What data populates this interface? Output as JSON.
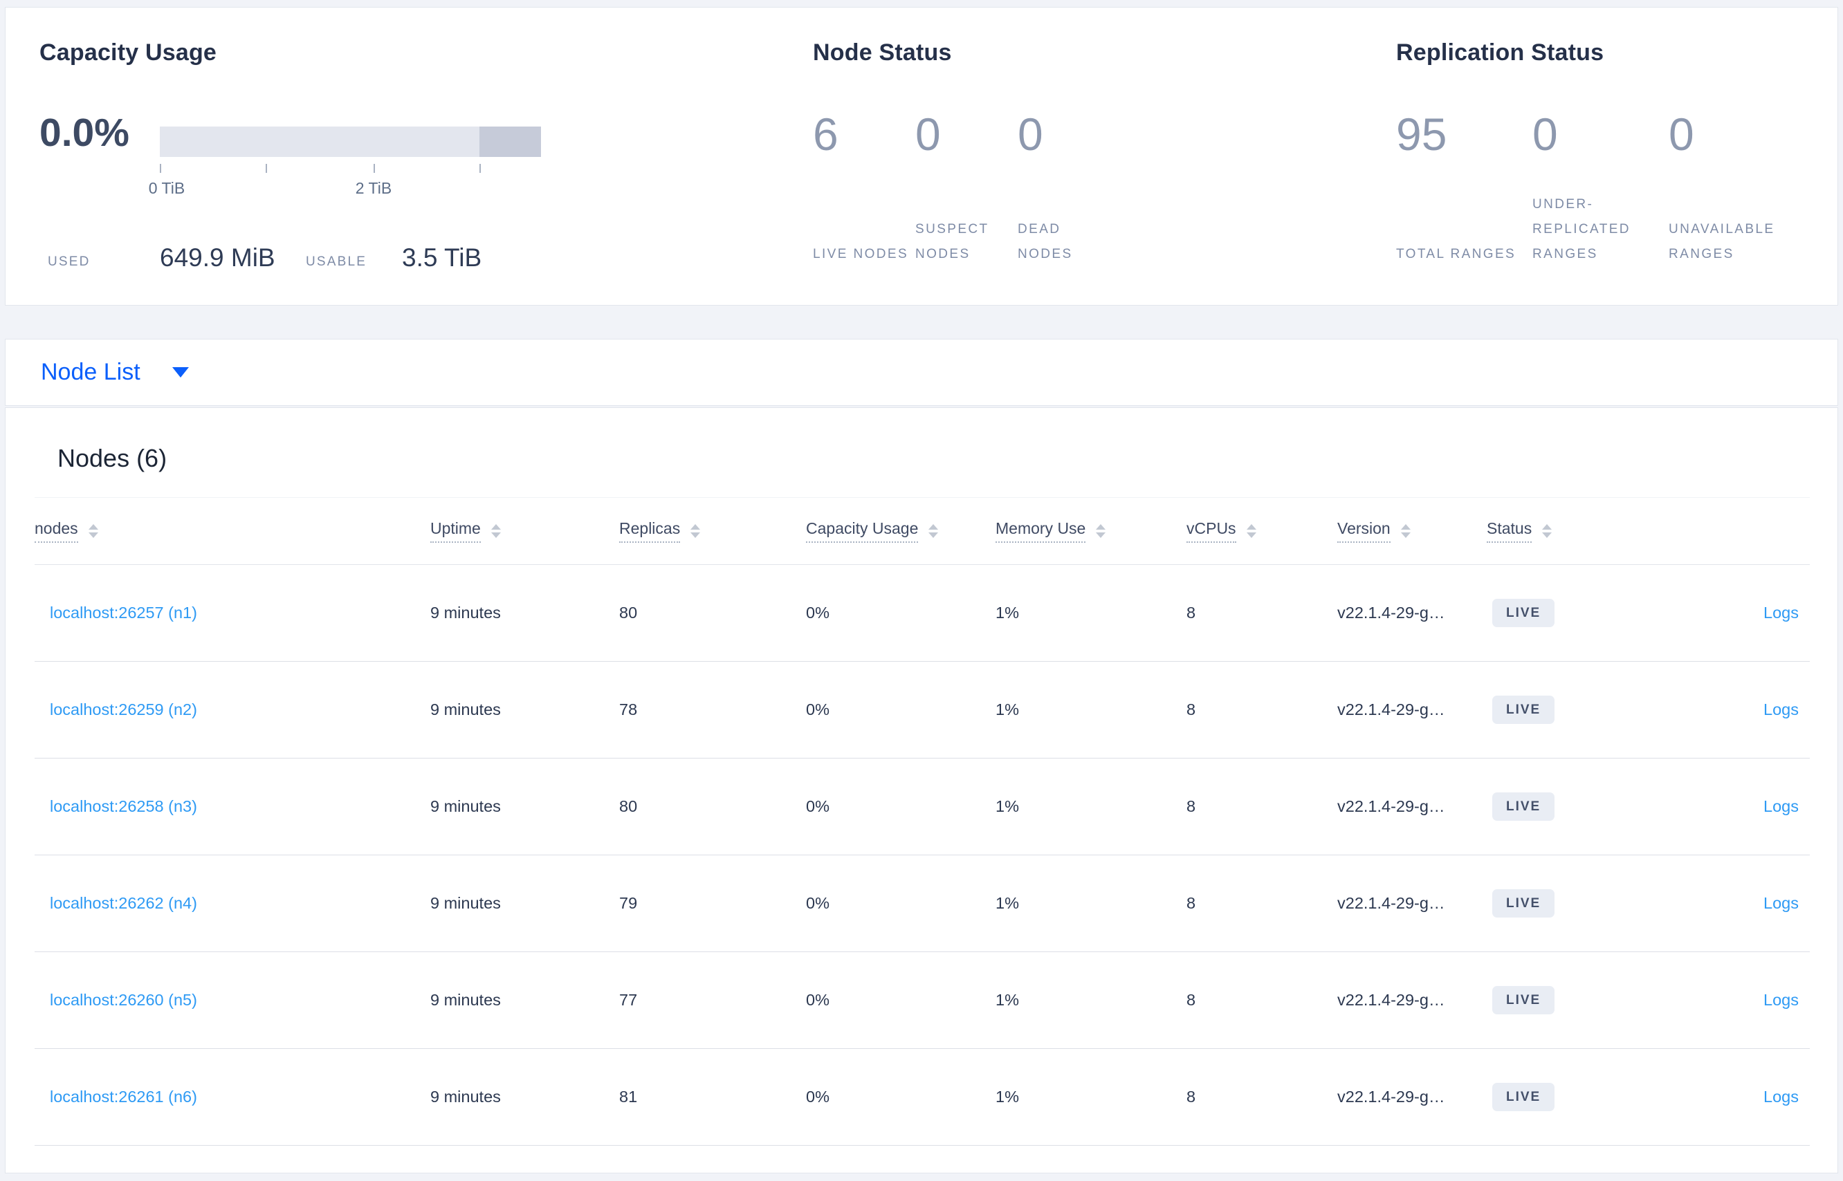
{
  "capacity_usage": {
    "title": "Capacity Usage",
    "percent_used": "0.0%",
    "tick_labels": [
      "0 TiB",
      "2 TiB"
    ],
    "used_label": "USED",
    "used_value": "649.9 MiB",
    "usable_label": "USABLE",
    "usable_value": "3.5 TiB"
  },
  "node_status": {
    "title": "Node Status",
    "stats": [
      {
        "value": "6",
        "label": "LIVE NODES"
      },
      {
        "value": "0",
        "label": "SUSPECT NODES"
      },
      {
        "value": "0",
        "label": "DEAD NODES"
      }
    ]
  },
  "replication_status": {
    "title": "Replication Status",
    "stats": [
      {
        "value": "95",
        "label": "TOTAL RANGES"
      },
      {
        "value": "0",
        "label": "UNDER-REPLICATED RANGES"
      },
      {
        "value": "0",
        "label": "UNAVAILABLE RANGES"
      }
    ]
  },
  "view_selector": {
    "selected": "Node List"
  },
  "nodes_table": {
    "title": "Nodes (6)",
    "columns": [
      {
        "label": "nodes"
      },
      {
        "label": "Uptime"
      },
      {
        "label": "Replicas"
      },
      {
        "label": "Capacity Usage"
      },
      {
        "label": "Memory Use"
      },
      {
        "label": "vCPUs"
      },
      {
        "label": "Version"
      },
      {
        "label": "Status"
      }
    ],
    "rows": [
      {
        "node": "localhost:26257 (n1)",
        "uptime": "9 minutes",
        "replicas": "80",
        "capacity": "0%",
        "memory": "1%",
        "vcpus": "8",
        "version": "v22.1.4-29-g…",
        "status": "LIVE",
        "logs_label": "Logs"
      },
      {
        "node": "localhost:26259 (n2)",
        "uptime": "9 minutes",
        "replicas": "78",
        "capacity": "0%",
        "memory": "1%",
        "vcpus": "8",
        "version": "v22.1.4-29-g…",
        "status": "LIVE",
        "logs_label": "Logs"
      },
      {
        "node": "localhost:26258 (n3)",
        "uptime": "9 minutes",
        "replicas": "80",
        "capacity": "0%",
        "memory": "1%",
        "vcpus": "8",
        "version": "v22.1.4-29-g…",
        "status": "LIVE",
        "logs_label": "Logs"
      },
      {
        "node": "localhost:26262 (n4)",
        "uptime": "9 minutes",
        "replicas": "79",
        "capacity": "0%",
        "memory": "1%",
        "vcpus": "8",
        "version": "v22.1.4-29-g…",
        "status": "LIVE",
        "logs_label": "Logs"
      },
      {
        "node": "localhost:26260 (n5)",
        "uptime": "9 minutes",
        "replicas": "77",
        "capacity": "0%",
        "memory": "1%",
        "vcpus": "8",
        "version": "v22.1.4-29-g…",
        "status": "LIVE",
        "logs_label": "Logs"
      },
      {
        "node": "localhost:26261 (n6)",
        "uptime": "9 minutes",
        "replicas": "81",
        "capacity": "0%",
        "memory": "1%",
        "vcpus": "8",
        "version": "v22.1.4-29-g…",
        "status": "LIVE",
        "logs_label": "Logs"
      }
    ]
  },
  "colors": {
    "accent_blue": "#0b5ffb",
    "link_blue": "#2e9af4",
    "badge_bg": "#e9edf4",
    "gauge_track": "#e3e6ee",
    "gauge_dark_segment": "#c6cbd9"
  }
}
